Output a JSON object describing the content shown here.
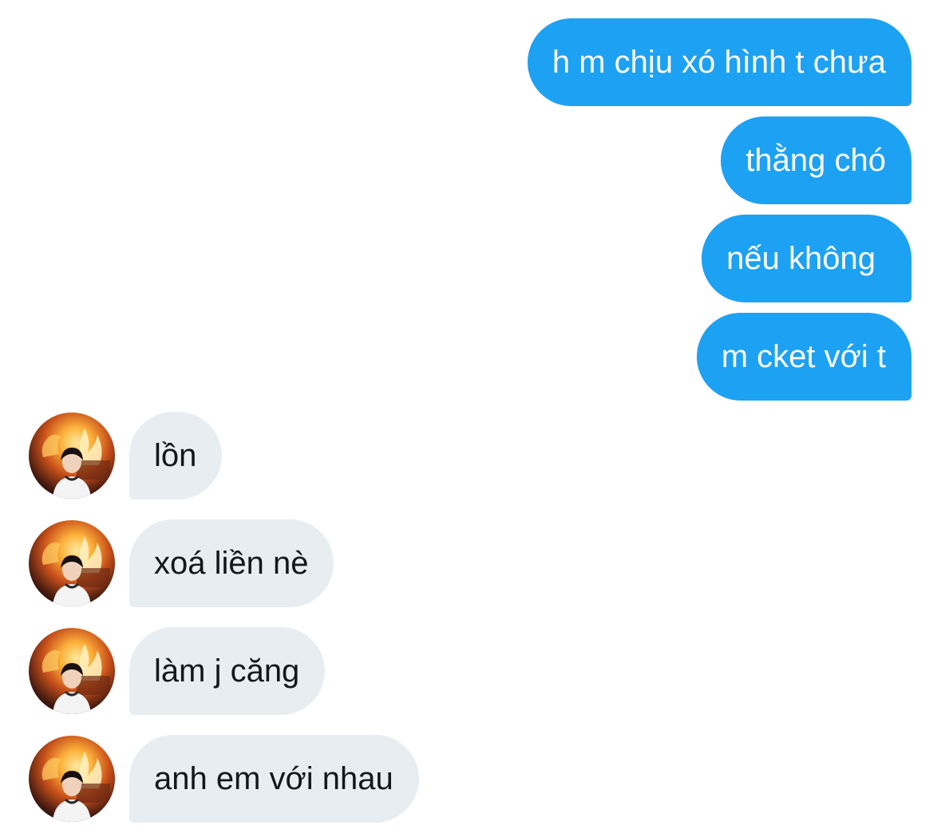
{
  "sent_messages": [
    {
      "text": "h m chịu xó hình t chưa"
    },
    {
      "text": "thằng chó"
    },
    {
      "text": "nếu không"
    },
    {
      "text": "m cket với t"
    }
  ],
  "received_messages": [
    {
      "text": "lồn"
    },
    {
      "text": "xoá liền nè"
    },
    {
      "text": "làm j căng"
    },
    {
      "text": "anh em với nhau"
    }
  ],
  "colors": {
    "sent_bubble": "#1da1f2",
    "received_bubble": "#e8edf1",
    "received_text": "#14171a"
  },
  "avatar": {
    "icon": "user-avatar-fire-background"
  }
}
